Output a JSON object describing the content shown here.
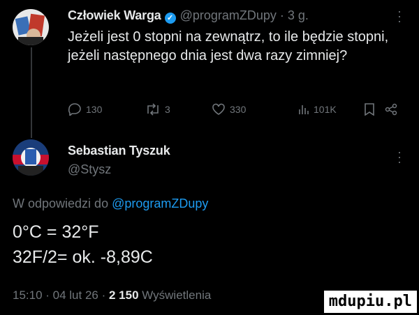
{
  "first_tweet": {
    "author_name": "Człowiek Warga",
    "handle_time": "@programZDupy · 3 g.",
    "text": "Jeżeli jest 0 stopni na zewnątrz, to ile będzie stopni, jeżeli następnego dnia jest dwa razy zimniej?",
    "actions": {
      "replies": "130",
      "retweets": "3",
      "likes": "330",
      "views": "101K"
    }
  },
  "reply_tweet": {
    "author_name": "Sebastian Tyszuk",
    "handle": "@Stysz",
    "replying_to_prefix": "W odpowiedzi do ",
    "replying_to_handle": "@programZDupy",
    "line1": "0°C = 32°F",
    "line2": "32F/2= ok. -8,89C",
    "time_date": "15:10 · 04 lut 26 · ",
    "views_count": "2 150",
    "views_label": " Wyświetlenia"
  },
  "watermark": "mdupiu.pl",
  "colors": {
    "background": "#000000",
    "text": "#e7e9ea",
    "muted": "#71767b",
    "link": "#1d9bf0",
    "verified": "#1d9bf0"
  },
  "icons": [
    "verified-badge-icon",
    "more-icon",
    "reply-icon",
    "retweet-icon",
    "like-icon",
    "views-icon",
    "bookmark-icon",
    "share-icon"
  ]
}
